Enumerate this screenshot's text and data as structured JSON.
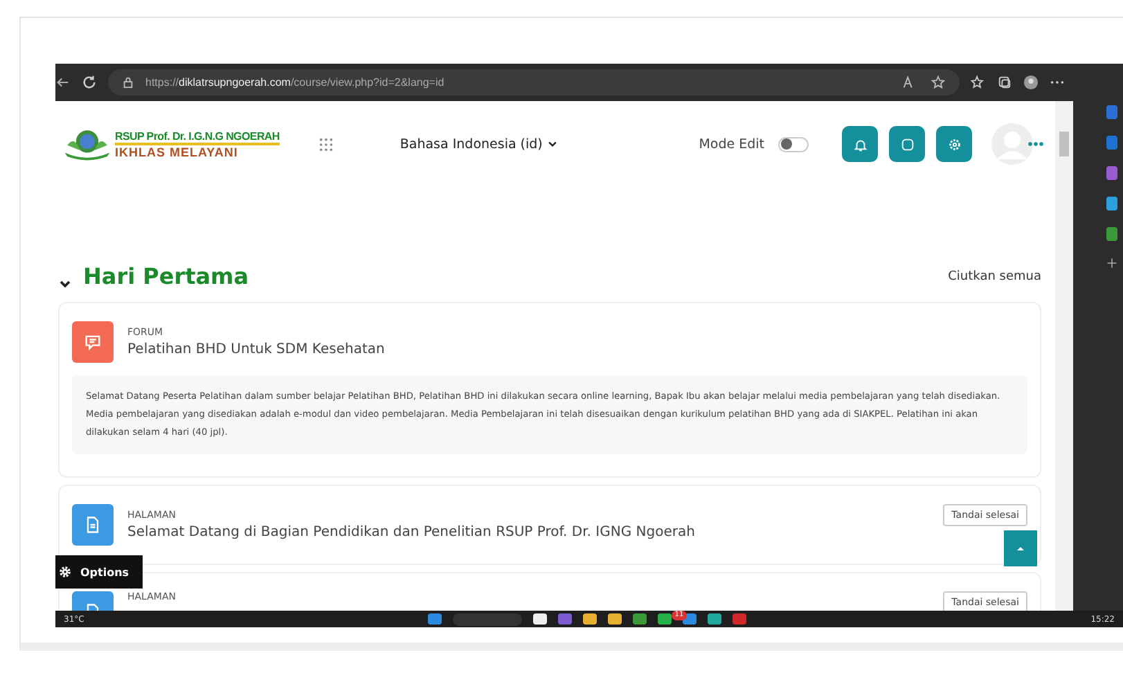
{
  "browser": {
    "url_scheme": "https://",
    "url_host": "diklatrsupngoerah.com",
    "url_path": "/course/view.php?id=2&lang=id"
  },
  "header": {
    "logo_title": "RSUP Prof. Dr. I.G.N.G NGOERAH",
    "logo_motto": "IKHLAS MELAYANI",
    "language": "Bahasa Indonesia (id)",
    "edit_mode_label": "Mode Edit",
    "edit_mode_on": false
  },
  "section": {
    "title": "Hari Pertama",
    "expanded": true,
    "collapse_all": "Ciutkan semua"
  },
  "activities": [
    {
      "kind": "forum",
      "type_label": "FORUM",
      "title": "Pelatihan BHD Untuk SDM Kesehatan",
      "description": "Selamat Datang Peserta Pelatihan dalam sumber belajar Pelatihan BHD, Pelatihan BHD ini dilakukan secara online learning, Bapak Ibu akan belajar melalui media pembelajaran yang telah disediakan. Media pembelajaran yang disediakan adalah e-modul dan video pembelajaran. Media Pembelajaran ini telah disesuaikan dengan kurikulum pelatihan BHD yang ada di SIAKPEL. Pelatihan ini akan dilakukan selam 4 hari (40 jpl)."
    },
    {
      "kind": "page",
      "type_label": "HALAMAN",
      "title": "Selamat Datang di Bagian Pendidikan dan Penelitian RSUP Prof. Dr. IGNG Ngoerah",
      "completion_button": "Tandai selesai"
    },
    {
      "kind": "page",
      "type_label": "HALAMAN",
      "completion_button": "Tandai selesai"
    }
  ],
  "options_button": "Options",
  "taskbar": {
    "weather": "31°C",
    "badge": "11",
    "time": "15:22"
  }
}
